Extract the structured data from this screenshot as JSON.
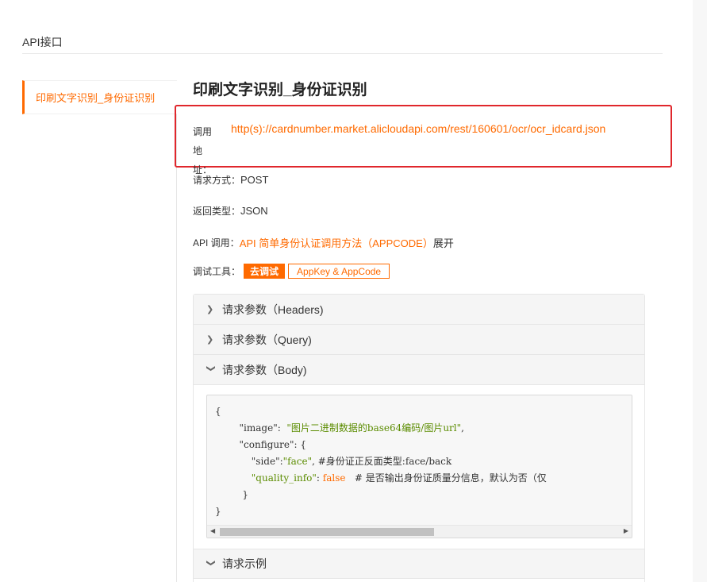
{
  "header": {
    "title": "API接口"
  },
  "sidebar": {
    "items": [
      {
        "label": "印刷文字识别_身份证识别"
      }
    ]
  },
  "api": {
    "title": "印刷文字识别_身份证识别",
    "url_label_1": "调用地",
    "url_label_2": "址：",
    "url": "http(s)://cardnumber.market.alicloudapi.com/rest/160601/ocr/ocr_idcard.json",
    "method_label": "请求方式：",
    "method": "POST",
    "return_label": "返回类型：",
    "return_type": "JSON",
    "call_label": "API 调用：",
    "call_link": "API 简单身份认证调用方法（APPCODE）",
    "expand": "展开",
    "tools_label": "调试工具：",
    "debug_button": "去调试",
    "appkey_button": "AppKey & AppCode"
  },
  "panel": {
    "sections": [
      {
        "label": "请求参数（Headers)",
        "state": "collapsed"
      },
      {
        "label": "请求参数（Query)",
        "state": "collapsed"
      },
      {
        "label": "请求参数（Body)",
        "state": "expanded"
      },
      {
        "label": "请求示例",
        "state": "expanded"
      }
    ],
    "code": {
      "l1": "{",
      "k_image": "\"image\"",
      "colon1": ":  ",
      "v_image": "\"图片二进制数据的base64编码/图片url\"",
      "comma1": ",",
      "k_configure": "\"configure\"",
      "open_brace": ": {",
      "k_side": "\"side\"",
      "colon2": ":",
      "v_side": "\"face\"",
      "c_side": ", #身份证正反面类型:face/back",
      "k_quality": "\"quality_info\"",
      "colon3": ": ",
      "v_quality": "false",
      "c_quality": "   # 是否输出身份证质量分信息，默认为否（仅",
      "close_inner": "}",
      "close_outer": "}"
    }
  },
  "colors": {
    "accent": "#ff6a00",
    "highlight": "#e0272c"
  }
}
